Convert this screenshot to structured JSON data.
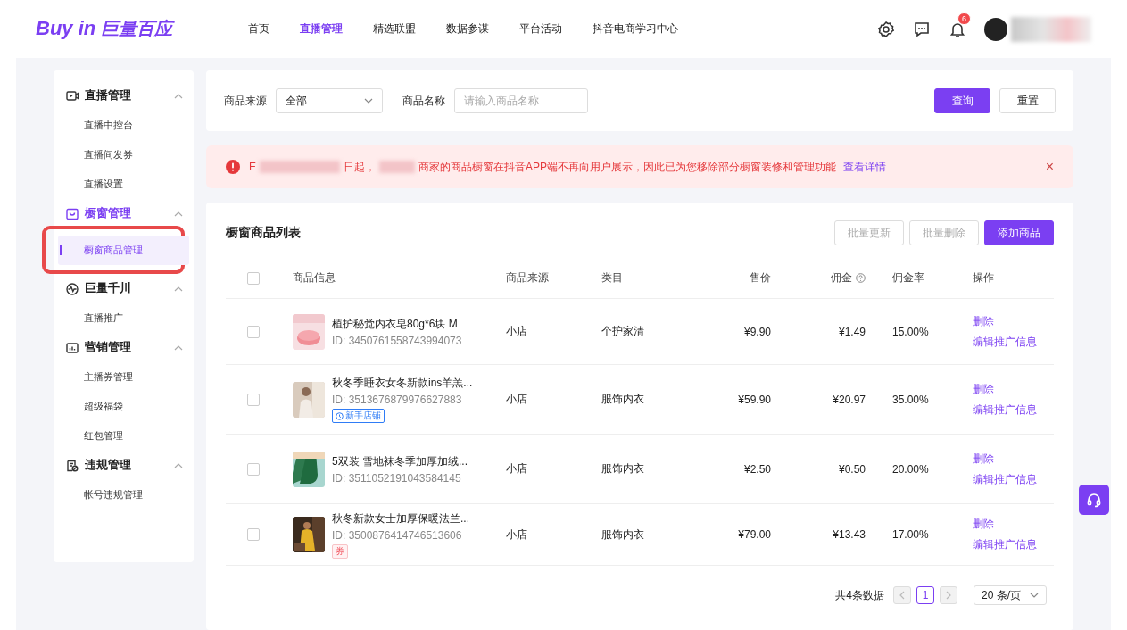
{
  "header": {
    "logo_latin": "Buy in",
    "logo_cn": "巨量百应",
    "nav": [
      {
        "label": "首页",
        "selected": false
      },
      {
        "label": "直播管理",
        "selected": true
      },
      {
        "label": "精选联盟",
        "selected": false
      },
      {
        "label": "数据参谋",
        "selected": false
      },
      {
        "label": "平台活动",
        "selected": false
      },
      {
        "label": "抖音电商学习中心",
        "selected": false
      }
    ],
    "notification_count": "6"
  },
  "sidebar": {
    "groups": [
      {
        "title": "直播管理",
        "selected": false,
        "expanded": true,
        "items": [
          {
            "label": "直播中控台",
            "selected": false,
            "highlighted": false
          },
          {
            "label": "直播间发券",
            "selected": false,
            "highlighted": false
          },
          {
            "label": "直播设置",
            "selected": false,
            "highlighted": false
          }
        ]
      },
      {
        "title": "橱窗管理",
        "selected": true,
        "expanded": true,
        "items": [
          {
            "label": "橱窗商品管理",
            "selected": true,
            "highlighted": true
          }
        ]
      },
      {
        "title": "巨量千川",
        "selected": false,
        "expanded": true,
        "items": [
          {
            "label": "直播推广",
            "selected": false,
            "highlighted": false
          }
        ]
      },
      {
        "title": "营销管理",
        "selected": false,
        "expanded": true,
        "items": [
          {
            "label": "主播券管理",
            "selected": false,
            "highlighted": false
          },
          {
            "label": "超级福袋",
            "selected": false,
            "highlighted": false
          },
          {
            "label": "红包管理",
            "selected": false,
            "highlighted": false
          }
        ]
      },
      {
        "title": "违规管理",
        "selected": false,
        "expanded": true,
        "items": [
          {
            "label": "帐号违规管理",
            "selected": false,
            "highlighted": false
          }
        ]
      }
    ]
  },
  "filters": {
    "source_label": "商品来源",
    "source_value": "全部",
    "name_label": "商品名称",
    "name_placeholder": "请输入商品名称",
    "buttons": [
      {
        "label": "查询",
        "kind": "primary"
      },
      {
        "label": "重置",
        "kind": "default"
      }
    ]
  },
  "notice": {
    "parts": [
      "E",
      "日起，",
      "商家的商品橱窗在抖音APP端不再向用户展示，因此已为您移除部分橱窗装修和管理功能"
    ],
    "link": "查看详情",
    "close": "×"
  },
  "list": {
    "title": "橱窗商品列表",
    "buttons": [
      {
        "label": "批量更新",
        "kind": "disabled"
      },
      {
        "label": "批量删除",
        "kind": "disabled"
      },
      {
        "label": "添加商品",
        "kind": "primary"
      }
    ],
    "select_all_checked": false,
    "columns": [
      "商品信息",
      "商品来源",
      "类目",
      "售价",
      "佣金",
      "佣金率",
      "操作"
    ],
    "rows": [
      {
        "checked": false,
        "name": "植护秘觉内衣皂80g*6块 M",
        "id": "ID: 3450761558743994073",
        "tag": null,
        "source": "小店",
        "category": "个护家清",
        "price": "¥9.90",
        "commission": "¥1.49",
        "rate": "15.00%",
        "actions": [
          "删除",
          "编辑推广信息"
        ]
      },
      {
        "checked": false,
        "name": "秋冬季睡衣女冬新款ins羊羔...",
        "id": "ID: 3513676879976627883",
        "tag": {
          "kind": "newshop",
          "label": "新手店铺"
        },
        "source": "小店",
        "category": "服饰内衣",
        "price": "¥59.90",
        "commission": "¥20.97",
        "rate": "35.00%",
        "actions": [
          "删除",
          "编辑推广信息"
        ]
      },
      {
        "checked": false,
        "name": "5双装 雪地袜冬季加厚加绒...",
        "id": "ID: 3511052191043584145",
        "tag": null,
        "source": "小店",
        "category": "服饰内衣",
        "price": "¥2.50",
        "commission": "¥0.50",
        "rate": "20.00%",
        "actions": [
          "删除",
          "编辑推广信息"
        ]
      },
      {
        "checked": false,
        "name": "秋冬新款女士加厚保暖法兰...",
        "id": "ID: 3500876414746513606",
        "tag": {
          "kind": "coupon",
          "label": "券"
        },
        "source": "小店",
        "category": "服饰内衣",
        "price": "¥79.00",
        "commission": "¥13.43",
        "rate": "17.00%",
        "actions": [
          "删除",
          "编辑推广信息"
        ]
      }
    ],
    "pagination": {
      "total": "共4条数据",
      "pages": [
        {
          "label": "1",
          "selected": true
        }
      ],
      "page_size": "20 条/页"
    }
  }
}
